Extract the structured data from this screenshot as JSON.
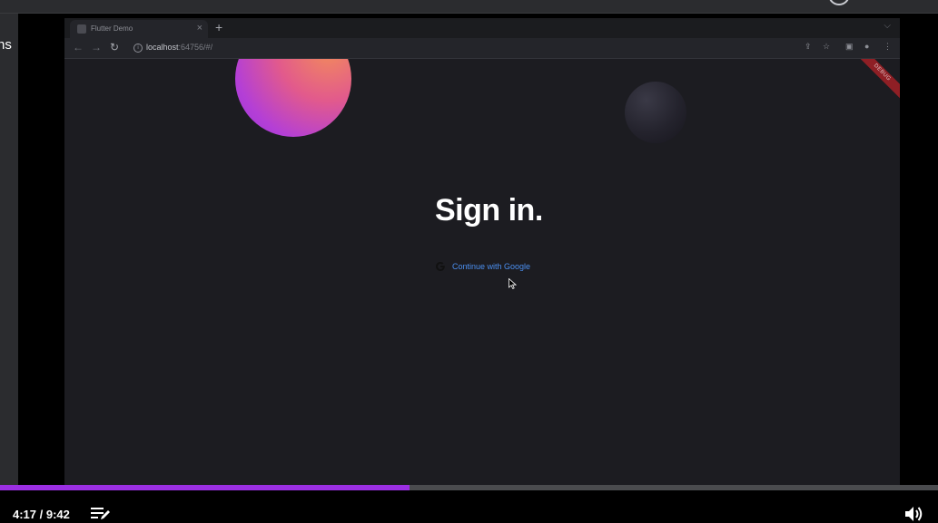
{
  "app_top": {
    "partial_text": "ns"
  },
  "browser": {
    "tab": {
      "title": "Flutter Demo",
      "close": "×"
    },
    "new_tab": "+",
    "url": {
      "host": "localhost",
      "rest": ":64756/#/"
    }
  },
  "app": {
    "debug_banner": "DEBUG",
    "title": "Sign in.",
    "google_button_label": "Continue with Google"
  },
  "player": {
    "time": "4:17 / 9:42",
    "progress_fraction": 0.437,
    "progress_color": "#9b2fe3",
    "icons": [
      "playlist-edit-icon",
      "volume-icon"
    ]
  }
}
